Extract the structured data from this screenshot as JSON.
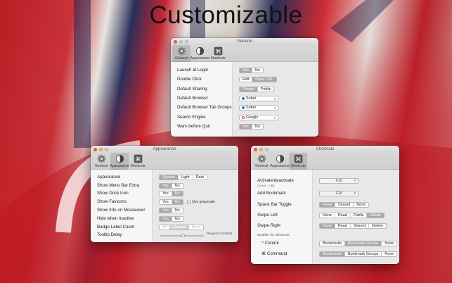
{
  "headline": "Customizable",
  "tabs": {
    "general": "General",
    "appearance": "Appearance",
    "shortcuts": "Shortcuts"
  },
  "general_window": {
    "title": "General",
    "rows": {
      "launch": {
        "label": "Launch at Login",
        "options": [
          "Yes",
          "No"
        ],
        "selected": "Yes"
      },
      "double_click": {
        "label": "Double Click",
        "options": [
          "Edit",
          "Open URL"
        ],
        "selected": "Open URL"
      },
      "sharing": {
        "label": "Default Sharing",
        "options": [
          "Private",
          "Public"
        ],
        "selected": "Private"
      },
      "browser": {
        "label": "Default Browser",
        "value": "Safari"
      },
      "browser_groups": {
        "label": "Default Browser Tab Groups",
        "value": "Safari"
      },
      "search": {
        "label": "Search Engine",
        "value": "Google"
      },
      "warn": {
        "label": "Warn before Quit",
        "options": [
          "Yes",
          "No"
        ],
        "selected": "Yes"
      }
    }
  },
  "appearance_window": {
    "title": "Appearance",
    "rows": {
      "appearance": {
        "label": "Appearance",
        "options": [
          "System",
          "Light",
          "Dark"
        ],
        "selected": "System"
      },
      "menu_bar_extra": {
        "label": "Show Menu Bar Extra",
        "options": [
          "Yes",
          "No"
        ],
        "selected": "Yes"
      },
      "dock_icon": {
        "label": "Show Dock Icon",
        "options": [
          "Yes",
          "No"
        ],
        "selected": "Yes"
      },
      "favicons": {
        "label": "Show Favicons",
        "options": [
          "Yes",
          "No"
        ],
        "selected": "Yes",
        "extra": "Use grayscale"
      },
      "mouseover": {
        "label": "Show Info on Mouseover",
        "options": [
          "Yes",
          "No"
        ],
        "selected": "Yes"
      },
      "hide_inactive": {
        "label": "Hide when Inactive",
        "options": [
          "Yes",
          "No"
        ],
        "selected": "Yes"
      },
      "badge": {
        "label": "Badge Label Count",
        "options": [
          "All",
          "Unread",
          "None"
        ],
        "selected": "Unread"
      },
      "tooltip": {
        "label": "Tooltip Delay",
        "note": "Requires Restart"
      }
    }
  },
  "shortcuts_window": {
    "title": "Shortcuts",
    "rows": {
      "activate": {
        "label": "Activate/deactivate",
        "sub": "Default: ⌥⌘B",
        "value": "F19"
      },
      "add_bookmark": {
        "label": "Add Bookmark",
        "value": "F18"
      },
      "space_bar": {
        "label": "Space Bar Toggle",
        "options": [
          "Read",
          "Shared",
          "None"
        ],
        "selected": "Read"
      },
      "swipe_left": {
        "label": "Swipe Left",
        "options": [
          "None",
          "Read",
          "Public",
          "Delete"
        ],
        "selected": "Delete"
      },
      "swipe_right": {
        "label": "Swipe Right",
        "options": [
          "None",
          "Read",
          "Shared",
          "Delete"
        ],
        "selected": "None"
      },
      "modifier_header": "Modifier for Shortcuts",
      "control": {
        "label": "^ Control",
        "options": [
          "Bookmarks",
          "Bookmark Groups",
          "None"
        ],
        "selected": "Bookmark Groups"
      },
      "command": {
        "label": "⌘ Command",
        "options": [
          "Bookmarks",
          "Bookmark Groups",
          "None"
        ],
        "selected": "Bookmarks"
      }
    }
  }
}
